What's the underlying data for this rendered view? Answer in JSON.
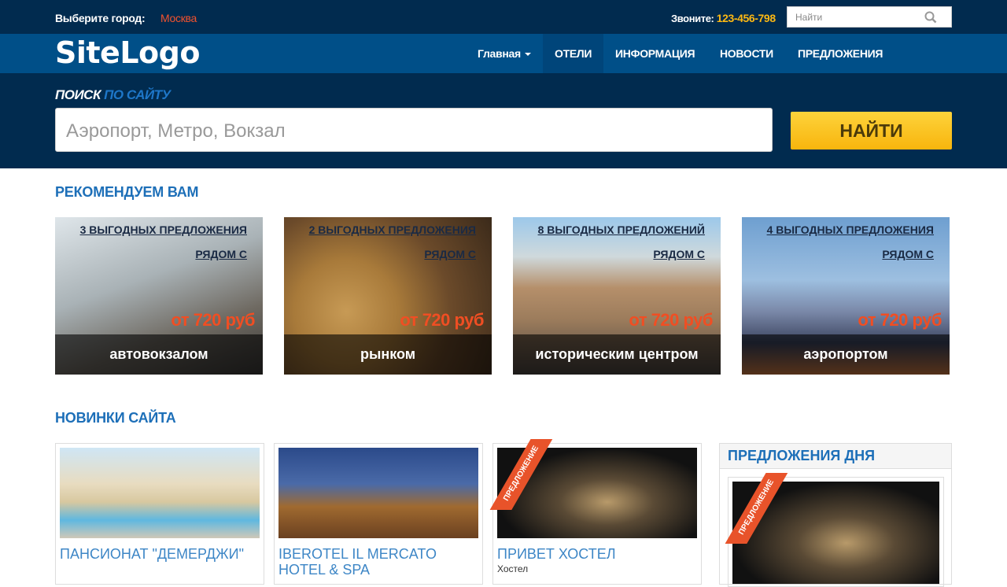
{
  "topbar": {
    "city_label": "Выберите город:",
    "city": "Москва",
    "call_label": "Звоните:",
    "phone": "123-456-798",
    "search_placeholder": "Найти"
  },
  "nav": {
    "logo": "SiteLogo",
    "items": [
      {
        "label": "Главная"
      },
      {
        "label": "ОТЕЛИ"
      },
      {
        "label": "ИНФОРМАЦИЯ"
      },
      {
        "label": "НОВОСТИ"
      },
      {
        "label": "ПРЕДЛОЖЕНИЯ"
      }
    ]
  },
  "search": {
    "title_a": "ПОИСК",
    "title_b": "ПО САЙТУ",
    "placeholder": "Аэропорт, Метро, Вокзал",
    "button": "НАЙТИ"
  },
  "recommend": {
    "title": "РЕКОМЕНДУЕМ ВАМ",
    "near_label": "РЯДОМ С",
    "cards": [
      {
        "deals": "3 ВЫГОДНЫХ ПРЕДЛОЖЕНИЯ",
        "price": "от 720 руб",
        "caption": "автовокзалом"
      },
      {
        "deals": "2 ВЫГОДНЫХ ПРЕДЛОЖЕНИЯ",
        "price": "от 720 руб",
        "caption": "рынком"
      },
      {
        "deals": "8 ВЫГОДНЫХ ПРЕДЛОЖЕНИЙ",
        "price": "от 720 руб",
        "caption": "историческим центром"
      },
      {
        "deals": "4 ВЫГОДНЫХ ПРЕДЛОЖЕНИЯ",
        "price": "от 720 руб",
        "caption": "аэропортом"
      }
    ]
  },
  "news": {
    "title": "НОВИНКИ САЙТА",
    "ribbon": "ПРЕДЛОЖЕНИЕ",
    "cards": [
      {
        "title": "ПАНСИОНАТ \"ДЕМЕРДЖИ\""
      },
      {
        "title": "IBEROTEL IL MERCATO HOTEL & SPA"
      },
      {
        "title": "ПРИВЕТ ХОСТЕЛ",
        "sub": "Хостел"
      }
    ]
  },
  "deals_of_day": {
    "title": "ПРЕДЛОЖЕНИЯ ДНЯ"
  }
}
